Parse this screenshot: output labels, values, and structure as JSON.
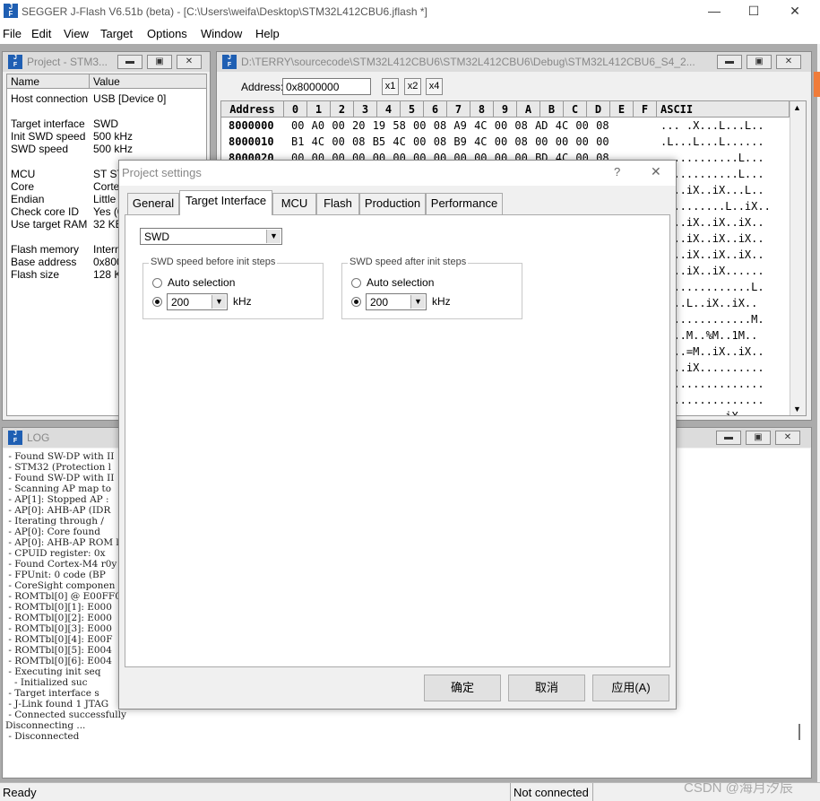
{
  "app": {
    "icon_text": "J\nFlash",
    "title": "SEGGER J-Flash V6.51b (beta) - [C:\\Users\\weifa\\Desktop\\STM32L412CBU6.jflash *]"
  },
  "window_controls": {
    "minimize": "—",
    "maximize": "☐",
    "close": "✕"
  },
  "menus": [
    "File",
    "Edit",
    "View",
    "Target",
    "Options",
    "Window",
    "Help"
  ],
  "project_window": {
    "title": "Project - STM3...",
    "col_name": "Name",
    "col_value": "Value",
    "rows": [
      {
        "name": "Host connection",
        "value": "USB [Device 0]"
      },
      {
        "name": "Target interface",
        "value": "SWD"
      },
      {
        "name": "Init SWD speed",
        "value": "500 kHz"
      },
      {
        "name": "SWD speed",
        "value": "500 kHz"
      },
      {
        "name": "MCU",
        "value": "ST ST"
      },
      {
        "name": "Core",
        "value": "Cortex"
      },
      {
        "name": "Endian",
        "value": "Little"
      },
      {
        "name": "Check core ID",
        "value": "Yes (0"
      },
      {
        "name": "Use target RAM",
        "value": "32 KB"
      },
      {
        "name": "Flash memory",
        "value": "Intern"
      },
      {
        "name": "Base address",
        "value": "0x800"
      },
      {
        "name": "Flash size",
        "value": "128 KI"
      }
    ]
  },
  "hex_window": {
    "title": "D:\\TERRY\\sourcecode\\STM32L412CBU6\\STM32L412CBU6\\Debug\\STM32L412CBU6_S4_2...",
    "address_label": "Address:",
    "address_value": "0x8000000",
    "zoom": [
      "x1",
      "x2",
      "x4"
    ],
    "header": {
      "address": "Address",
      "cols": [
        "0",
        "1",
        "2",
        "3",
        "4",
        "5",
        "6",
        "7",
        "8",
        "9",
        "A",
        "B",
        "C",
        "D",
        "E",
        "F"
      ],
      "ascii": "ASCII"
    },
    "rows": [
      {
        "addr": "8000000",
        "bytes": "00 A0 00 20 19 58 00 08 A9 4C 00 08 AD 4C 00 08",
        "ascii": "... .X...L...L.."
      },
      {
        "addr": "8000010",
        "bytes": "B1 4C 00 08 B5 4C 00 08 B9 4C 00 08 00 00 00 00",
        "ascii": ".L...L...L......"
      },
      {
        "addr": "8000020",
        "bytes": "00 00 00 00 00 00 00 00 00 00 00 00 BD 4C 00 08",
        "ascii": "............L..."
      }
    ],
    "ascii_visible": [
      "............L...",
      "....iX..iX...L..",
      "..........L..iX..",
      "....iX..iX..iX..",
      "....iX..iX..iX..",
      "....iX..iX..iX..",
      "....iX..iX......",
      "..............L.",
      "....L..iX..iX..",
      "..............M.",
      "....M..%M..1M..",
      "....=M..iX..iX..",
      "....iX..........",
      "................",
      "................",
      "..........iX....",
      "....iX..iX......"
    ]
  },
  "log_window": {
    "title": "LOG",
    "lines": [
      " - Found SW-DP with II",
      " - STM32 (Protection l",
      " - Found SW-DP with II",
      " - Scanning AP map to",
      " - AP[1]: Stopped AP :",
      " - AP[0]: AHB-AP (IDR",
      " - Iterating through /",
      " - AP[0]: Core found",
      " - AP[0]: AHB-AP ROM l",
      " - CPUID register: 0x",
      " - Found Cortex-M4 r0y",
      " - FPUnit: 0 code (BP",
      " - CoreSight componen",
      " - ROMTbl[0] @ E00FF0",
      " - ROMTbl[0][1]: E000",
      " - ROMTbl[0][2]: E000",
      " - ROMTbl[0][3]: E000",
      " - ROMTbl[0][4]: E00F",
      " - ROMTbl[0][5]: E004",
      " - ROMTbl[0][6]: E004",
      " - Executing init seq",
      "   - Initialized suc",
      " - Target interface s",
      " - J-Link found 1 JTAG",
      " - Connected successfully",
      "Disconnecting ...",
      " - Disconnected"
    ]
  },
  "status_bar": {
    "left": "Ready",
    "right": "Not connected",
    "watermark": "CSDN @海月汐辰"
  },
  "dialog": {
    "title": "Project settings",
    "help": "?",
    "close": "✕",
    "tabs": [
      "General",
      "Target Interface",
      "MCU",
      "Flash",
      "Production",
      "Performance"
    ],
    "active_tab": "Target Interface",
    "interface_value": "SWD",
    "group_before": {
      "label": "SWD speed before init steps",
      "auto": "Auto selection",
      "speed": "200",
      "unit": "kHz",
      "selected": "manual"
    },
    "group_after": {
      "label": "SWD speed after init steps",
      "auto": "Auto selection",
      "speed": "200",
      "unit": "kHz",
      "selected": "manual"
    },
    "buttons": {
      "ok": "确定",
      "cancel": "取消",
      "apply": "应用(A)"
    }
  },
  "colors": {
    "highlight_box": "#e53935",
    "accent": "#1f5fb3"
  }
}
